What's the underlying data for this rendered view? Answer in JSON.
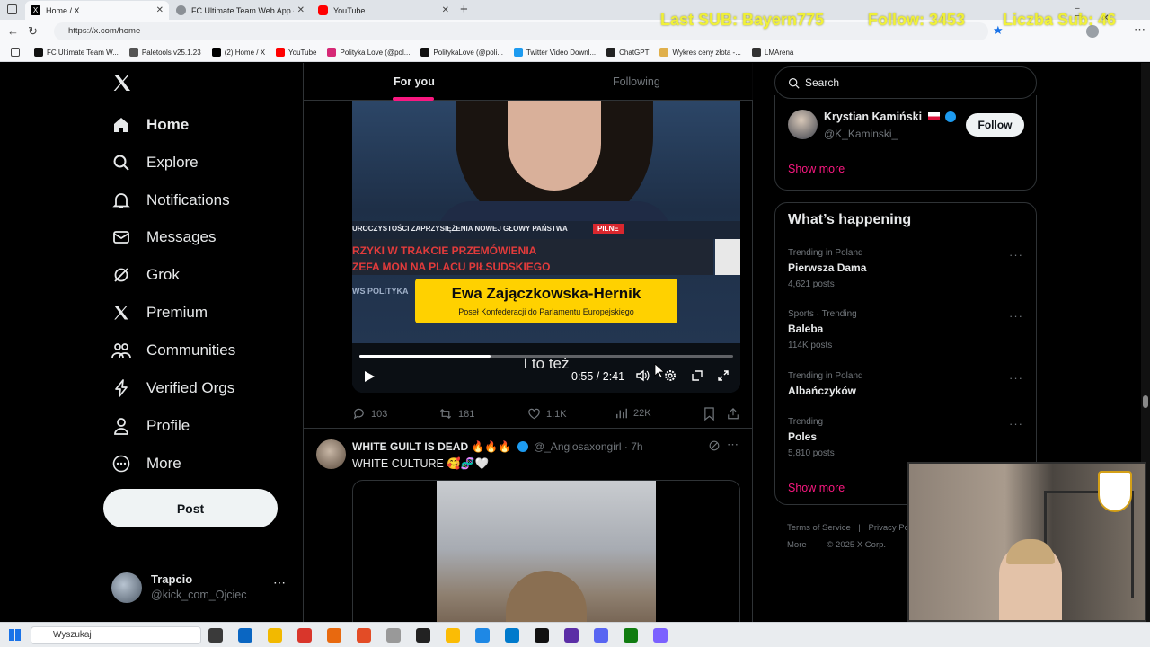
{
  "browser": {
    "tabs": [
      {
        "label": "Home / X",
        "active": true,
        "favicon_color": "#000000"
      },
      {
        "label": "FC Ultimate Team Web App - EA S",
        "active": false,
        "favicon_color": "#6f7378"
      },
      {
        "label": "YouTube",
        "active": false,
        "favicon_color": "#ff0000"
      }
    ],
    "url": "https://x.com/home",
    "bookmarks": [
      {
        "label": "FC Ultimate Team W...",
        "color": "#111111"
      },
      {
        "label": "Paletools v25.1.23",
        "color": "#555555"
      },
      {
        "label": "(2) Home / X",
        "color": "#000000"
      },
      {
        "label": "YouTube",
        "color": "#ff0000"
      },
      {
        "label": "Polityka Love (@pol...",
        "color": "#d62976"
      },
      {
        "label": "PolitykaLove (@poli...",
        "color": "#111111"
      },
      {
        "label": "Twitter Video Downl...",
        "color": "#1d9bf0"
      },
      {
        "label": "ChatGPT",
        "color": "#222222"
      },
      {
        "label": "Wykres ceny złota -...",
        "color": "#e0b04c"
      },
      {
        "label": "LMArena",
        "color": "#333333"
      }
    ]
  },
  "stream_overlay": {
    "last_sub": "Last SUB: Bayern775",
    "follow": "Follow: 3453",
    "sub_count": "Liczba Sub: 46"
  },
  "sidebar": {
    "nav": [
      {
        "label": "Home",
        "icon": "home-icon"
      },
      {
        "label": "Explore",
        "icon": "search-icon"
      },
      {
        "label": "Notifications",
        "icon": "bell-icon"
      },
      {
        "label": "Messages",
        "icon": "mail-icon"
      },
      {
        "label": "Grok",
        "icon": "grok-icon"
      },
      {
        "label": "Premium",
        "icon": "x-logo-icon"
      },
      {
        "label": "Communities",
        "icon": "people-icon"
      },
      {
        "label": "Verified Orgs",
        "icon": "lightning-icon"
      },
      {
        "label": "Profile",
        "icon": "person-icon"
      },
      {
        "label": "More",
        "icon": "more-circle-icon"
      }
    ],
    "post_label": "Post",
    "account": {
      "name": "Trapcio",
      "handle": "@kick_com_Ojciec"
    }
  },
  "feed": {
    "tabs": [
      "For you",
      "Following"
    ],
    "active_tab": 0,
    "video": {
      "ticker_top": "UROCZYSTOŚCI ZAPRZYSIĘŻENIA NOWEJ GŁOWY PAŃSTWA",
      "ticker_badge": "PILNE",
      "headline_line1": "RZYKI W TRAKCIE PRZEMÓWIENIA",
      "headline_line2": "ZEFA MON NA PLACU PIŁSUDSKIEGO",
      "channel_strip": "WS POLITYKA",
      "lower_third_name": "Ewa Zajączkowska-Hernik",
      "lower_third_role": "Poseł Konfederacji do Parlamentu Europejskiego",
      "subtitle": "I to też",
      "time": "0:55 / 2:41",
      "progress": 0.35
    },
    "actions": {
      "replies": "103",
      "reposts": "181",
      "likes": "1.1K",
      "views": "22K"
    },
    "post2": {
      "author": "WHITE GUILT IS DEAD 🔥🔥🔥",
      "handle": "@_Anglosaxongirl",
      "time": "· 7h",
      "text": "WHITE CULTURE 🥰🧬🤍"
    }
  },
  "right": {
    "search_placeholder": "Search",
    "who_to_follow": {
      "name": "Krystian Kamiński",
      "handle": "@K_Kaminski_",
      "follow_label": "Follow"
    },
    "show_more": "Show more",
    "whats_happening_title": "What’s happening",
    "trends": [
      {
        "meta": "Trending in Poland",
        "name": "Pierwsza Dama",
        "count": "4,621 posts"
      },
      {
        "meta": "Sports · Trending",
        "name": "Baleba",
        "count": "114K posts"
      },
      {
        "meta": "Trending in Poland",
        "name": "Albańczyków",
        "count": ""
      },
      {
        "meta": "Trending",
        "name": "Poles",
        "count": "5,810 posts"
      }
    ],
    "show_more_2": "Show more",
    "footer_terms": "Terms of Service",
    "footer_privacy": "Privacy Po",
    "footer_more": "More ···",
    "footer_copy": "© 2025 X Corp."
  },
  "taskbar": {
    "search_placeholder": "Wyszukaj"
  },
  "colors": {
    "accent": "#f91880",
    "verified": "#1d9bf0",
    "yellow_banner": "#ffd100"
  }
}
